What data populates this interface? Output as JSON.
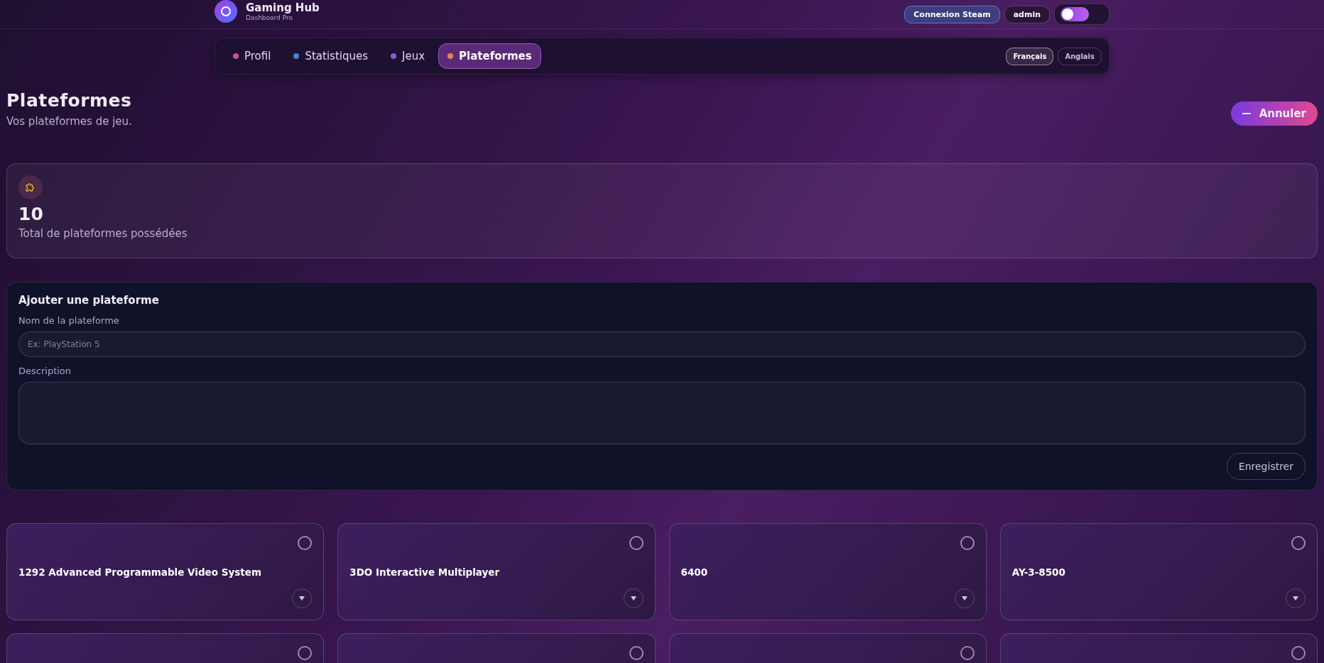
{
  "brand": {
    "title": "Gaming Hub",
    "subtitle": "Dashboard Pro"
  },
  "top_actions": {
    "steam_button": "Connexion Steam",
    "user": "admin",
    "theme_toggle": {
      "on": false
    }
  },
  "nav_tabs": [
    {
      "label": "Profil",
      "color": "#d0509a",
      "selected": false
    },
    {
      "label": "Statistiques",
      "color": "#4a7fd0",
      "selected": false
    },
    {
      "label": "Jeux",
      "color": "#8a5ad0",
      "selected": false
    },
    {
      "label": "Plateformes",
      "color": "#e08a50",
      "selected": true
    }
  ],
  "languages": [
    {
      "label": "Français",
      "selected": true
    },
    {
      "label": "Anglais",
      "selected": false
    }
  ],
  "page": {
    "title": "Plateformes",
    "subtitle": "Vos plateformes de jeu.",
    "cancel_button": "Annuler"
  },
  "stats": {
    "value": "10",
    "label": "Total de plateformes possédées"
  },
  "form": {
    "title": "Ajouter une plateforme",
    "name_label": "Nom de la plateforme",
    "name_placeholder": "Ex: PlayStation 5",
    "description_label": "Description",
    "save_button": "Enregistrer"
  },
  "platforms": [
    {
      "name": "1292 Advanced Programmable Video System",
      "selected": false
    },
    {
      "name": "3DO Interactive Multiplayer",
      "selected": false
    },
    {
      "name": "6400",
      "selected": false
    },
    {
      "name": "AY-3-8500",
      "selected": false
    },
    {
      "selected": false
    },
    {
      "selected": false
    },
    {
      "selected": false
    },
    {
      "selected": false
    }
  ]
}
